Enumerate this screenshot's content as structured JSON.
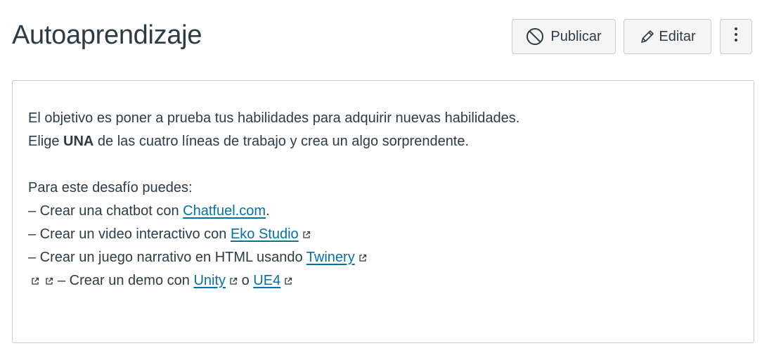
{
  "header": {
    "title": "Autoaprendizaje",
    "publish_label": "Publicar",
    "edit_label": "Editar"
  },
  "content": {
    "intro": "El objetivo es poner a prueba tus habilidades para adquirir nuevas habilidades.",
    "line2_pre": "Elige ",
    "line2_bold": "UNA",
    "line2_post": " de las cuatro líneas de trabajo y crea un algo sorprendente.",
    "challenge_heading": "Para este desafío puedes:",
    "items": [
      {
        "pre": "– Crear una chatbot con ",
        "link": "Chatfuel.com",
        "post": "."
      },
      {
        "pre": "– Crear un video interactivo con ",
        "link": "Eko Studio"
      },
      {
        "pre": "– Crear un juego narrativo en HTML usando ",
        "link": "Twinery"
      },
      {
        "pre": "– Crear un demo con ",
        "link": "Unity",
        "mid": " o ",
        "link2": "UE4"
      }
    ]
  },
  "colors": {
    "text": "#2D3B45",
    "link": "#0770A3",
    "button_bg": "#F5F5F5",
    "border": "#C7CDD1"
  },
  "icons": [
    "cancel-icon",
    "pencil-icon",
    "kebab-menu-icon",
    "external-link-icon"
  ]
}
